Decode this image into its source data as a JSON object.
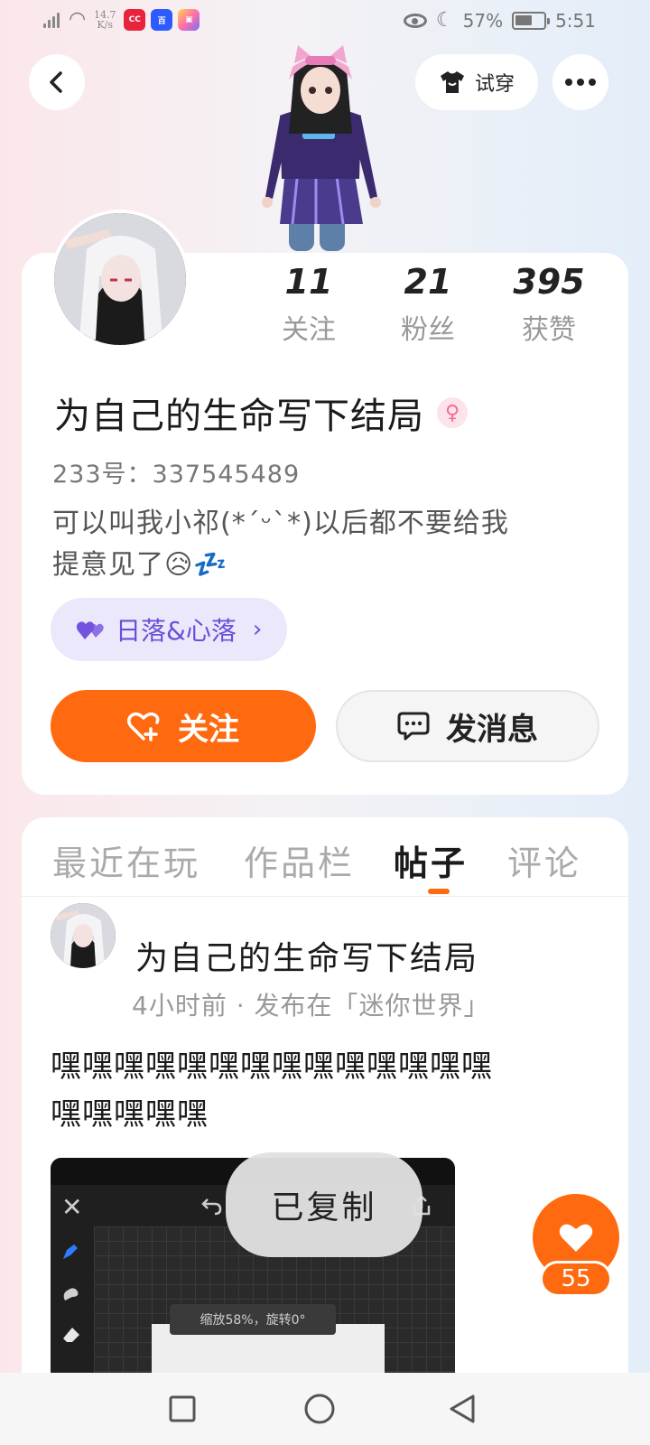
{
  "status_bar": {
    "speed_value": "14.7",
    "speed_unit": "K/s",
    "battery": "57%",
    "time": "5:51",
    "apps": [
      {
        "name": "cc-app-icon",
        "color": "#e8233e"
      },
      {
        "name": "baidu-app-icon",
        "color": "#2d5bff"
      },
      {
        "name": "colorful-app-icon",
        "color": "#ff7aa8"
      }
    ]
  },
  "header": {
    "tryon_label": "试穿"
  },
  "profile": {
    "stats": [
      {
        "value": "11",
        "label": "关注"
      },
      {
        "value": "21",
        "label": "粉丝"
      },
      {
        "value": "395",
        "label": "获赞"
      }
    ],
    "username": "为自己的生命写下结局",
    "gender_symbol": "♀",
    "uid": "233号：337545489",
    "bio_line1": "可以叫我小祁(*´ᵕ`*)以后都不要给我",
    "bio_line2": "提意见了😥💤",
    "group_tag": "日落&心落",
    "follow_label": "关注",
    "message_label": "发消息"
  },
  "tabs": [
    {
      "label": "最近在玩",
      "active": false
    },
    {
      "label": "作品栏",
      "active": false
    },
    {
      "label": "帖子",
      "active": true
    },
    {
      "label": "评论",
      "active": false
    }
  ],
  "post": {
    "author": "为自己的生命写下结局",
    "meta": "4小时前 · 发布在「迷你世界」",
    "text_line1": "嘿嘿嘿嘿嘿嘿嘿嘿嘿嘿嘿嘿嘿嘿",
    "text_line2": "嘿嘿嘿嘿嘿",
    "image_zoom_text": "缩放58%，旋转0°"
  },
  "toast": "已复制",
  "like": {
    "count": "55"
  },
  "colors": {
    "accent": "#ff6a10",
    "group_tag_text": "#6b4ed8",
    "group_tag_bg": "#ece8fb"
  }
}
